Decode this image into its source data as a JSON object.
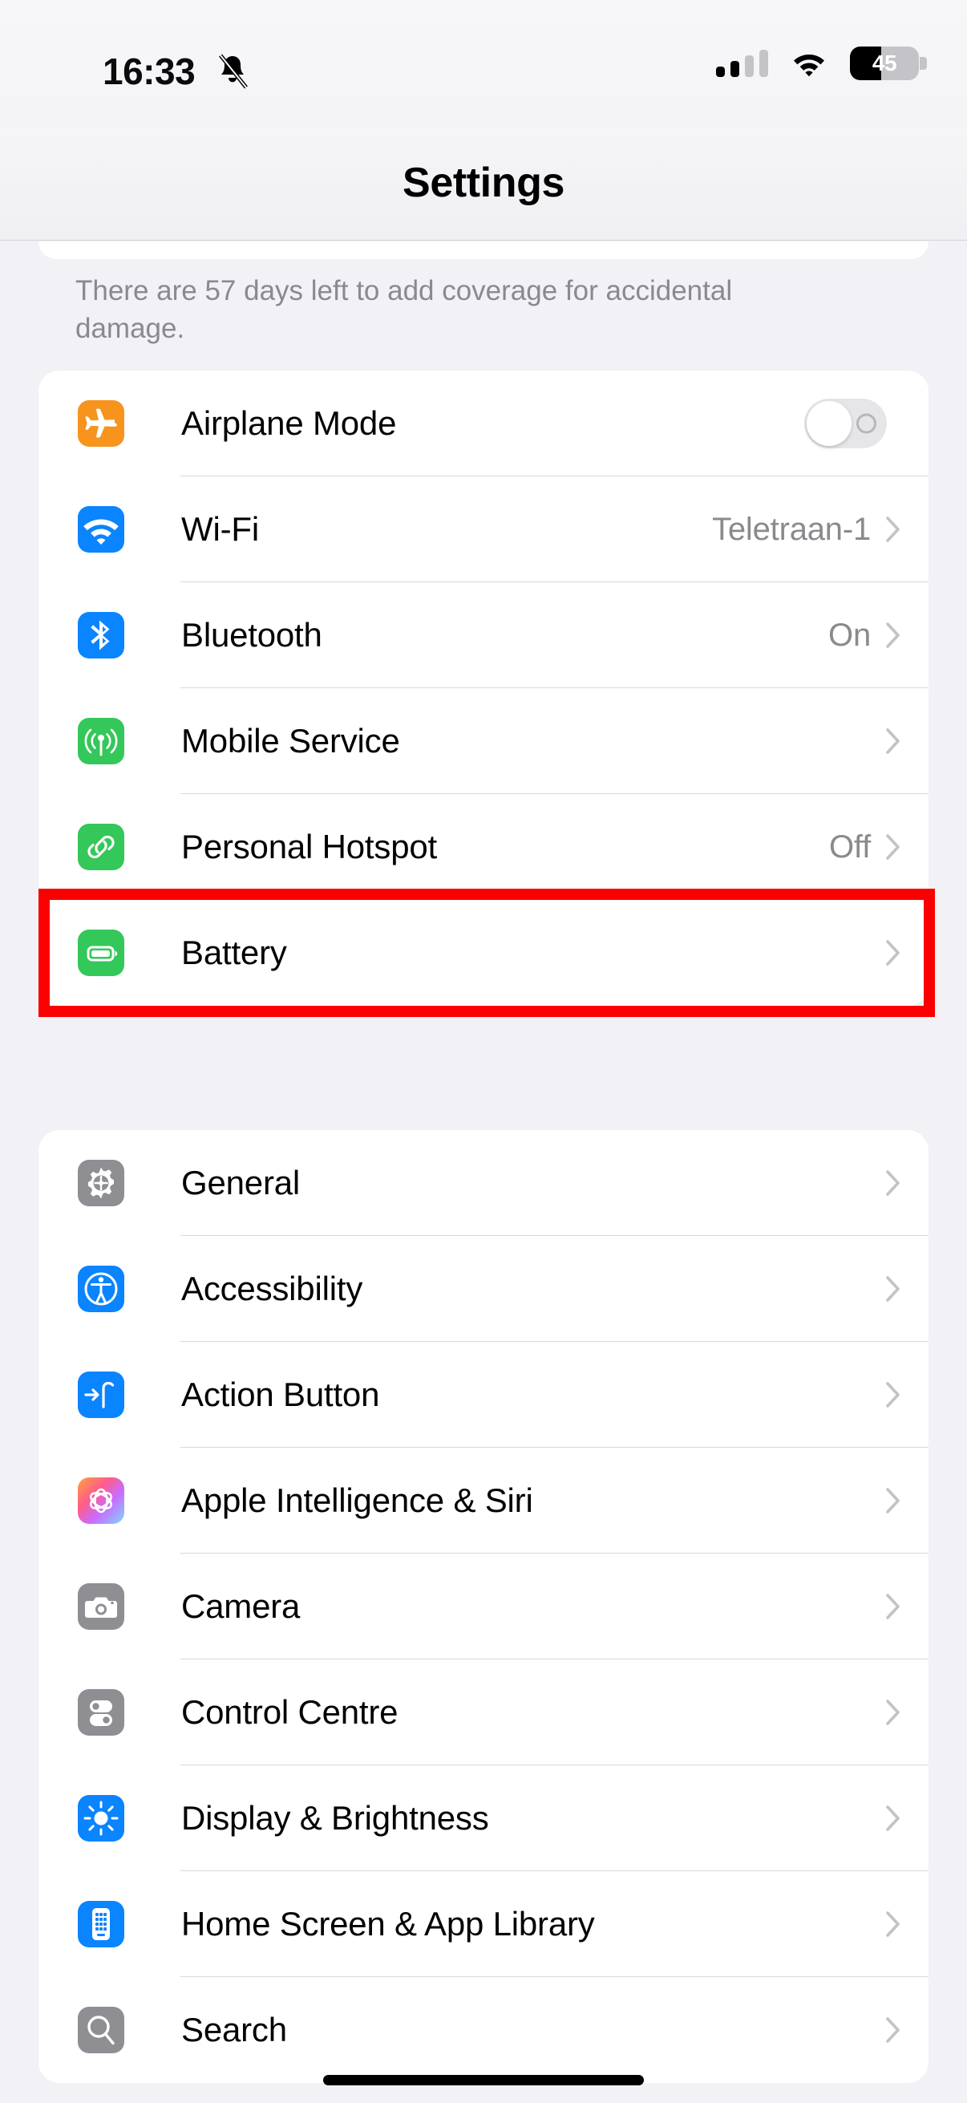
{
  "status_bar": {
    "time": "16:33",
    "silent_icon": "bell-slash-icon",
    "cellular_bars_filled": 2,
    "cellular_bars_total": 4,
    "wifi_icon": "wifi-icon",
    "battery_percent": "45",
    "battery_level": 45
  },
  "header": {
    "title": "Settings"
  },
  "footnote": {
    "text": "There are 57 days left to add coverage for accidental damage."
  },
  "groups": [
    {
      "id": "connectivity",
      "rows": [
        {
          "label": "Airplane Mode",
          "icon": "airplane-icon",
          "icon_color": "#f7941d",
          "control": "toggle",
          "toggle_on": false,
          "value": ""
        },
        {
          "label": "Wi-Fi",
          "icon": "wifi-icon",
          "icon_color": "#0a84ff",
          "control": "chevron",
          "value": "Teletraan-1"
        },
        {
          "label": "Bluetooth",
          "icon": "bluetooth-icon",
          "icon_color": "#0a84ff",
          "control": "chevron",
          "value": "On"
        },
        {
          "label": "Mobile Service",
          "icon": "antenna-icon",
          "icon_color": "#34c759",
          "control": "chevron",
          "value": ""
        },
        {
          "label": "Personal Hotspot",
          "icon": "hotspot-link-icon",
          "icon_color": "#34c759",
          "control": "chevron",
          "value": "Off"
        },
        {
          "label": "Battery",
          "icon": "battery-icon",
          "icon_color": "#34c759",
          "control": "chevron",
          "value": "",
          "highlighted": true
        }
      ]
    },
    {
      "id": "system",
      "rows": [
        {
          "label": "General",
          "icon": "gear-icon",
          "icon_color": "#8e8e93",
          "control": "chevron",
          "value": ""
        },
        {
          "label": "Accessibility",
          "icon": "accessibility-icon",
          "icon_color": "#0a84ff",
          "control": "chevron",
          "value": ""
        },
        {
          "label": "Action Button",
          "icon": "action-button-icon",
          "icon_color": "#0a84ff",
          "control": "chevron",
          "value": ""
        },
        {
          "label": "Apple Intelligence & Siri",
          "icon": "apple-intelligence-icon",
          "icon_color": "gradient",
          "control": "chevron",
          "value": ""
        },
        {
          "label": "Camera",
          "icon": "camera-icon",
          "icon_color": "#8e8e93",
          "control": "chevron",
          "value": ""
        },
        {
          "label": "Control Centre",
          "icon": "control-centre-icon",
          "icon_color": "#8e8e93",
          "control": "chevron",
          "value": ""
        },
        {
          "label": "Display & Brightness",
          "icon": "brightness-icon",
          "icon_color": "#0a84ff",
          "control": "chevron",
          "value": ""
        },
        {
          "label": "Home Screen & App Library",
          "icon": "home-screen-icon",
          "icon_color": "#0a84ff",
          "control": "chevron",
          "value": ""
        },
        {
          "label": "Search",
          "icon": "search-icon",
          "icon_color": "#8e8e93",
          "control": "chevron",
          "value": ""
        }
      ]
    }
  ],
  "annotation": {
    "color": "#fb0000",
    "target": "Battery"
  }
}
